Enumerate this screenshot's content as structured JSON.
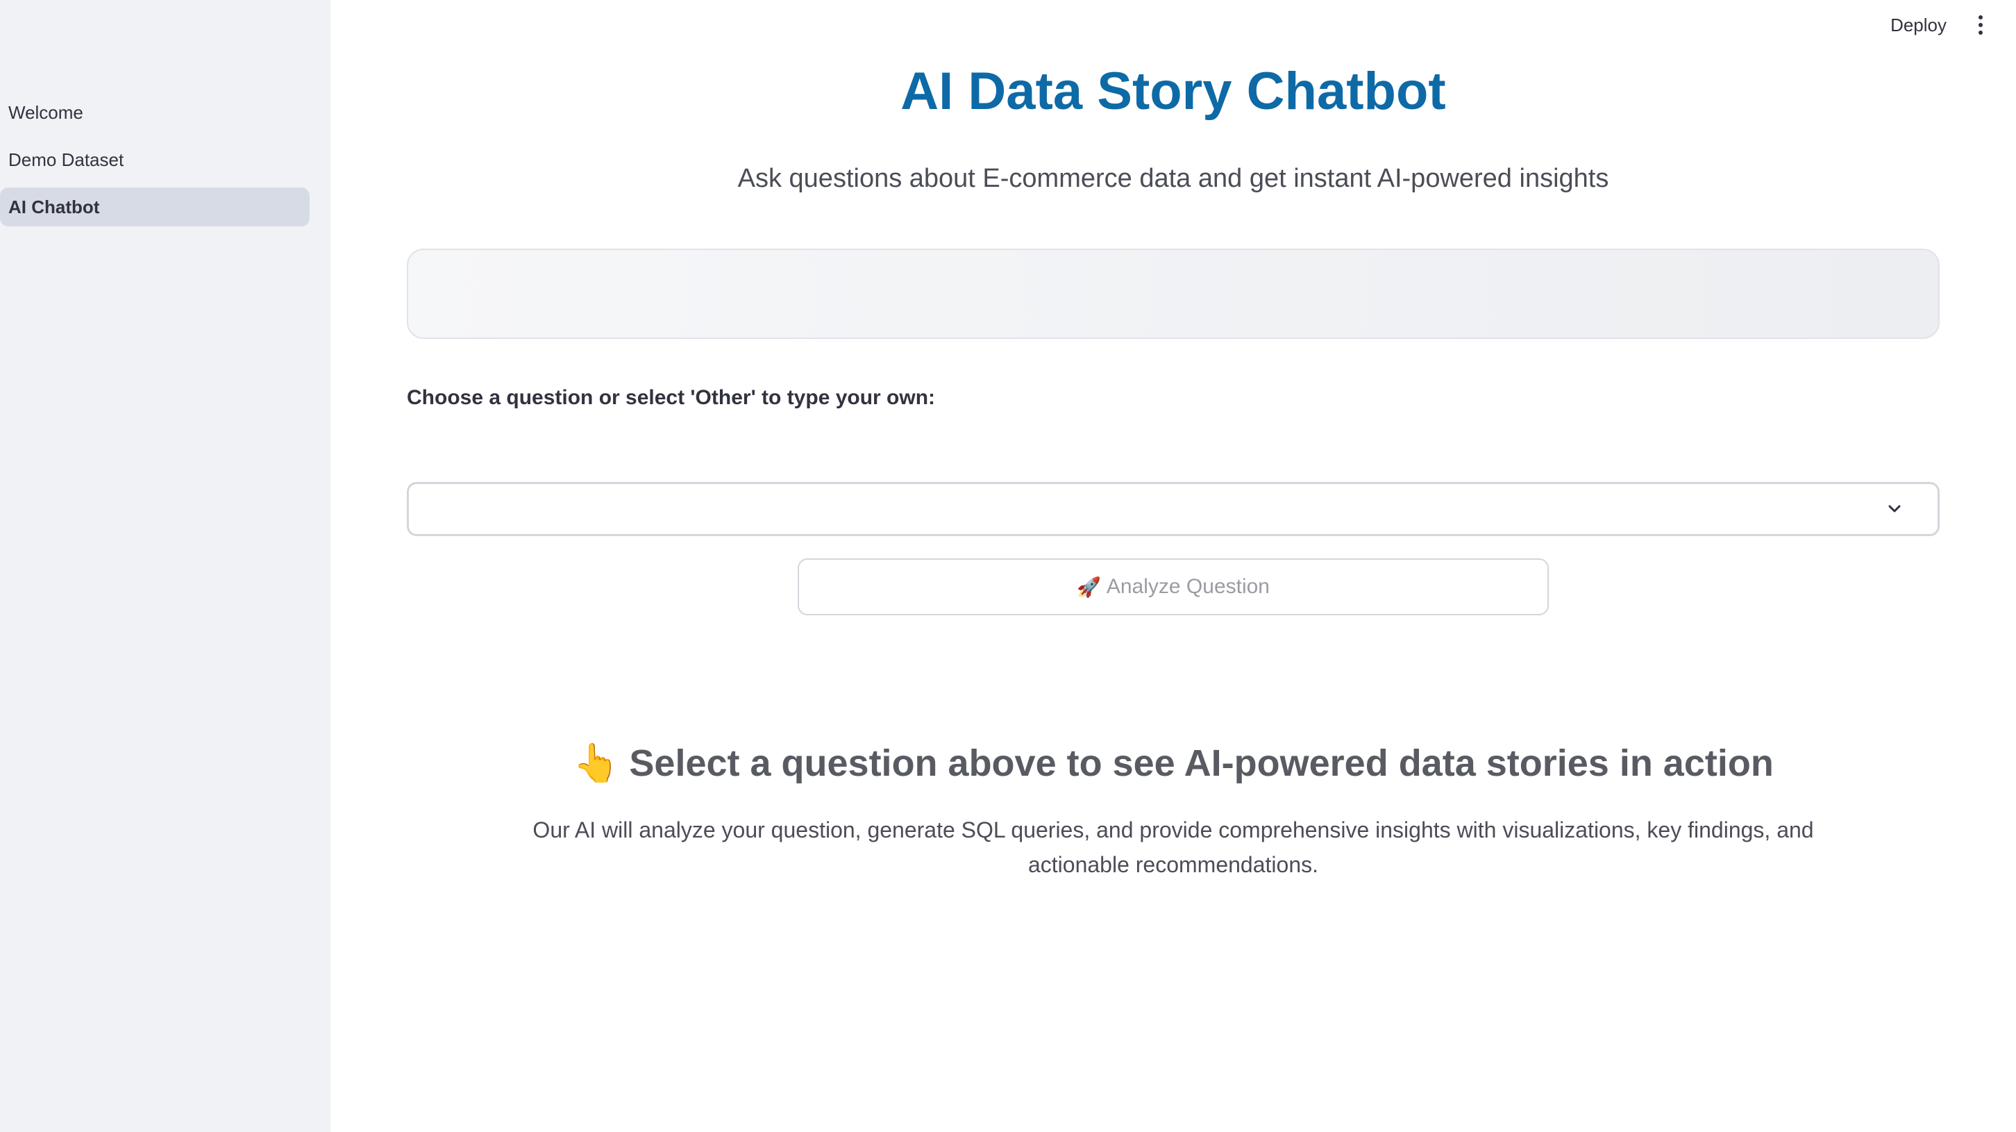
{
  "sidebar": {
    "items": [
      {
        "label": "Welcome"
      },
      {
        "label": "Demo Dataset"
      },
      {
        "label": "AI Chatbot",
        "active": true
      }
    ]
  },
  "header": {
    "deploy_label": "Deploy",
    "menu_icon": "kebab-menu-icon"
  },
  "main": {
    "title": "AI Data Story Chatbot",
    "subtitle": "Ask questions about E-commerce data and get instant AI-powered insights",
    "select_label": "Choose a question or select 'Other' to type your own:",
    "select_value": "",
    "analyze_icon": "🚀",
    "analyze_label": "Analyze Question",
    "cta_icon": "👆",
    "cta_heading": "Select a question above to see AI-powered data stories in action",
    "description": "Our AI will analyze your question, generate SQL queries, and provide comprehensive insights with visualizations, key findings, and actionable recommendations."
  },
  "colors": {
    "title": "#0e6aa6",
    "sidebar_bg": "#f0f2f6",
    "active_nav_bg": "#d7dbe5"
  }
}
